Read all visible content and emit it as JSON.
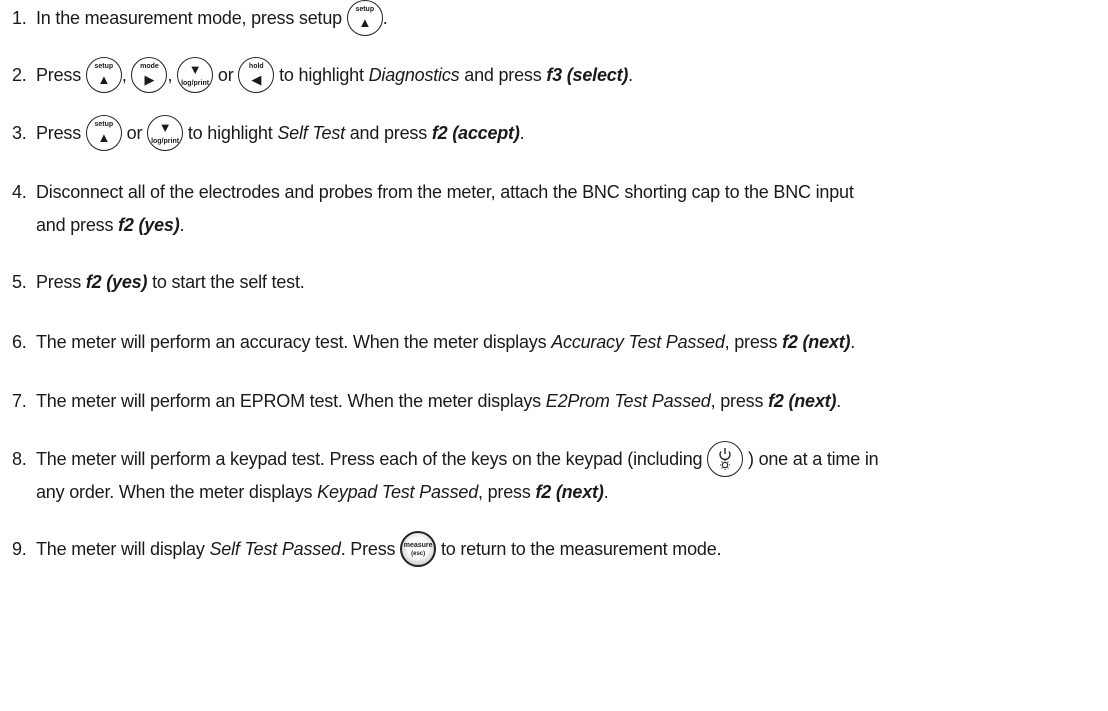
{
  "steps": [
    {
      "num": "1.",
      "t1": "In the measurement mode, press setup",
      "t2": "."
    },
    {
      "num": "2.",
      "t1": "Press",
      "sep1": ",",
      "sep2": ",",
      "or": "or",
      "t2": "to highlight",
      "item": "Diagnostics",
      "t3": "and press",
      "key": "f3 (select)",
      "t4": "."
    },
    {
      "num": "3.",
      "t1": "Press",
      "or": "or",
      "t2": "to highlight",
      "item": "Self Test",
      "t3": "and press",
      "key": "f2 (accept)",
      "t4": "."
    },
    {
      "num": "4.",
      "t1": "Disconnect all of the electrodes and probes from the meter, attach the BNC shorting cap to the BNC input",
      "t2": "and press",
      "key": "f2 (yes)",
      "t3": "."
    },
    {
      "num": "5.",
      "t1": "Press",
      "key": "f2 (yes)",
      "t2": "to start the self test."
    },
    {
      "num": "6.",
      "t1": "The meter will perform an accuracy test. When the meter displays",
      "item": "Accuracy Test Passed",
      "t2": ", press",
      "key": "f2 (next)",
      "t3": "."
    },
    {
      "num": "7.",
      "t1": "The meter will perform an EPROM test. When the meter displays",
      "item": "E2Prom Test Passed",
      "t2": ", press",
      "key": "f2 (next)",
      "t3": "."
    },
    {
      "num": "8.",
      "t1": "The meter will perform a keypad test. Press each of the keys on the keypad (including",
      "t2": ") one at a time in",
      "t3": "any order. When the meter displays",
      "item": "Keypad Test Passed",
      "t4": ", press",
      "key": "f2 (next)",
      "t5": "."
    },
    {
      "num": "9.",
      "t1": "The meter will display",
      "item": "Self Test Passed",
      "t2": ". Press",
      "t3": "to return to the measurement mode."
    }
  ],
  "keys": {
    "setup": {
      "label": "setup",
      "arrow": "▲",
      "icon": "setup-up-arrow-icon"
    },
    "mode": {
      "label": "mode",
      "arrow": "▶",
      "icon": "mode-right-arrow-icon"
    },
    "logprint": {
      "label": "log/print",
      "arrow": "▼",
      "icon": "log-print-down-arrow-icon"
    },
    "hold": {
      "label": "hold",
      "arrow": "◀",
      "icon": "hold-left-arrow-icon"
    },
    "power": {
      "icon": "power-light-icon"
    },
    "measure": {
      "label": "measure",
      "sub": "(esc)",
      "icon": "measure-esc-key-icon"
    }
  }
}
